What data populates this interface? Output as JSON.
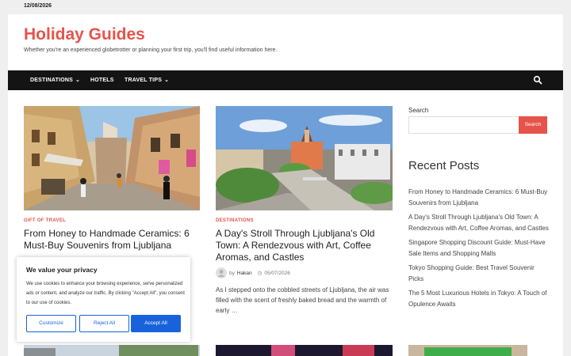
{
  "topbar": {
    "date": "12/08/2026"
  },
  "site": {
    "title": "Holiday Guides",
    "description": "Whether you're an experienced globetrotter or planning your first trip, you'll find useful information here."
  },
  "nav": {
    "items": [
      {
        "label": "DESTINATIONS",
        "has_dropdown": true
      },
      {
        "label": "HOTELS",
        "has_dropdown": false
      },
      {
        "label": "TRAVEL TIPS",
        "has_dropdown": true
      }
    ],
    "search_icon": "search-icon"
  },
  "posts": [
    {
      "category": "GIFT OF TRAVEL",
      "title": "From Honey to Handmade Ceramics: 6 Must-Buy Souvenirs from Ljubljana",
      "excerpt": ""
    },
    {
      "category": "DESTINATIONS",
      "title": "A Day's Stroll Through Ljubljana's Old Town: A Rendezvous with Art, Coffee Aromas, and Castles",
      "by": "by",
      "author": "Hakan",
      "date": "05/07/2026",
      "excerpt": "As I stepped onto the cobbled streets of Ljubljana, the air was filled with the scent of freshly baked bread and the warmth of early …"
    }
  ],
  "sidebar": {
    "search_label": "Search",
    "search_placeholder": "",
    "search_button": "Search",
    "recent_title": "Recent Posts",
    "recent_posts": [
      "From Honey to Handmade Ceramics: 6 Must-Buy Souvenirs from Ljubljana",
      "A Day's Stroll Through Ljubljana's Old Town: A Rendezvous with Art, Coffee Aromas, and Castles",
      "Singapore Shopping Discount Guide: Must-Have Sale Items and Shopping Malls",
      "Tokyo Shopping Guide: Best Travel Souvenir Picks",
      "The 5 Most Luxurious Hotels in Tokyo: A Touch of Opulence Awaits"
    ]
  },
  "cookie": {
    "title": "We value your privacy",
    "text": "We use cookies to enhance your browsing experience, serve personalized ads or content, and analyze our traffic. By clicking \"Accept All\", you consent to our use of cookies.",
    "customize": "Customize",
    "reject": "Reject All",
    "accept": "Accept All"
  },
  "colors": {
    "accent": "#e5534b",
    "nav_bg": "#141414",
    "cookie_blue": "#1863dc"
  }
}
